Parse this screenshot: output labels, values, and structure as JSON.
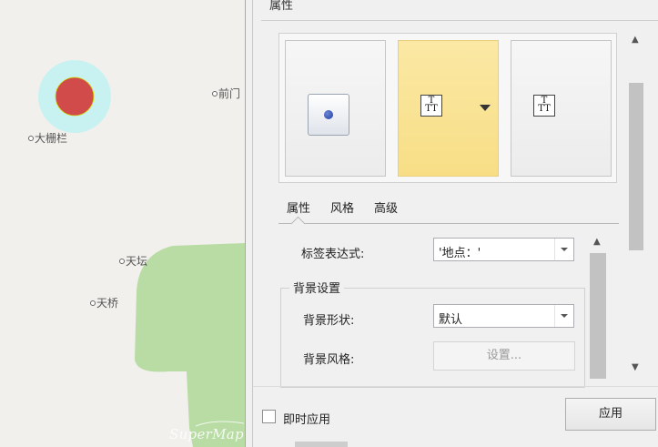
{
  "map": {
    "poi": [
      "大栅栏",
      "前门",
      "天坛",
      "天桥"
    ],
    "watermark": "SuperMap",
    "colors": {
      "background": "#f2f0ec",
      "park": "#b8dca4",
      "marker_inner": "#d24b4b",
      "marker_halo": "#c8f2f2"
    }
  },
  "panel": {
    "title": "属性",
    "gallery": {
      "tiles": [
        {
          "icon": "point-style-icon",
          "selected": false
        },
        {
          "icon": "text-style-icon",
          "selected": true,
          "has_dropdown": true
        },
        {
          "icon": "text-style-icon",
          "selected": false
        }
      ],
      "tt_glyph_top": "T",
      "tt_glyph_bottom": "TT"
    },
    "tabs": [
      {
        "label": "属性",
        "active": true
      },
      {
        "label": "风格",
        "active": false
      },
      {
        "label": "高级",
        "active": false
      }
    ],
    "label_expression": {
      "label": "标签表达式:",
      "value": "'地点：'"
    },
    "background_group": {
      "title": "背景设置",
      "shape": {
        "label": "背景形状:",
        "value": "默认"
      },
      "style": {
        "label": "背景风格:",
        "button": "设置..."
      }
    },
    "instant_apply": {
      "label": "即时应用",
      "checked": false
    },
    "apply_button": "应用",
    "scroll_up": "▲",
    "scroll_down": "▼"
  }
}
